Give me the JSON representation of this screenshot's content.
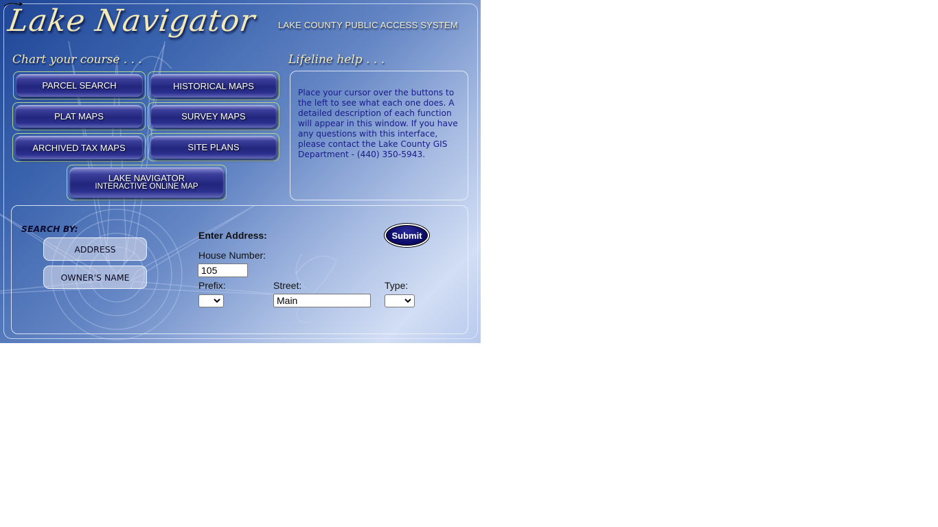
{
  "header": {
    "logo_text": "Lake Navigator",
    "tagline": "LAKE COUNTY PUBLIC ACCESS SYSTEM"
  },
  "chart_your_course": {
    "heading": "Chart your course . . .",
    "buttons": [
      {
        "label": "PARCEL SEARCH"
      },
      {
        "label": "HISTORICAL MAPS"
      },
      {
        "label": "PLAT MAPS"
      },
      {
        "label": "SURVEY MAPS"
      },
      {
        "label": "ARCHIVED TAX MAPS"
      },
      {
        "label": "SITE PLANS"
      }
    ],
    "interactive_map": {
      "line1": "LAKE NAVIGATOR",
      "line2": "INTERACTIVE ONLINE MAP"
    }
  },
  "lifeline_help": {
    "heading": "Lifeline help . . .",
    "text": "Place your cursor over the buttons to the left to see what each one does. A detailed description of each function will appear in this window. If you have any questions with this interface, please contact the Lake County GIS Department - (440) 350-5943."
  },
  "search": {
    "search_by_label": "SEARCH BY:",
    "options": [
      {
        "label": "ADDRESS"
      },
      {
        "label": "OWNER'S NAME"
      }
    ],
    "form": {
      "title": "Enter Address:",
      "house_number_label": "House Number:",
      "house_number_value": "105",
      "prefix_label": "Prefix:",
      "prefix_value": "",
      "street_label": "Street:",
      "street_value": "Main",
      "type_label": "Type:",
      "type_value": "",
      "submit_label": "Submit"
    }
  },
  "colors": {
    "heading_gold": "#f3e9b6",
    "help_text": "#1a1a8c",
    "nav_button": "#22267d",
    "nav_border": "#b7d58f",
    "submit": "#0c0c6a"
  }
}
